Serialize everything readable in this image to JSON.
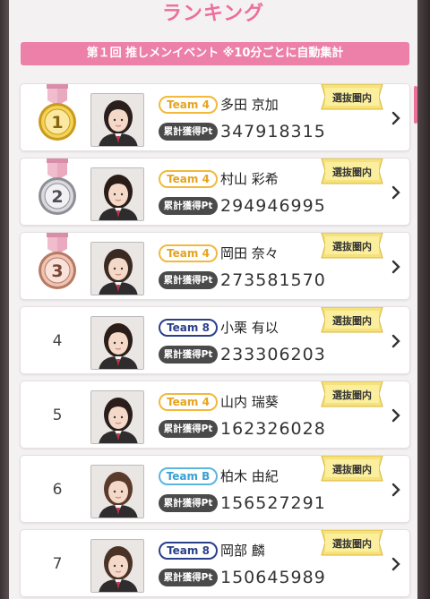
{
  "title": "ランキング",
  "banner": "第１回 推しメンイベント ※10分ごとに自動集計",
  "pt_label": "累計獲得Pt",
  "selected_label": "選抜圏内",
  "colors": {
    "accent_pink": "#ec6f9c",
    "banner_pink": "#ec80a8",
    "team4": "#f2b93b",
    "team8": "#2a3f8a",
    "teamB": "#5ab6e0",
    "gold": "#f4d35a",
    "silver": "#cfcfd4",
    "bronze": "#e8b9a8"
  },
  "rankings": [
    {
      "rank": "1",
      "medal": "gold-medal-icon",
      "team": "Team 4",
      "team_key": "team4",
      "name": "多田 京加",
      "points": "347918315",
      "selected": true
    },
    {
      "rank": "2",
      "medal": "silver-medal-icon",
      "team": "Team 4",
      "team_key": "team4",
      "name": "村山 彩希",
      "points": "294946995",
      "selected": true
    },
    {
      "rank": "3",
      "medal": "bronze-medal-icon",
      "team": "Team 4",
      "team_key": "team4",
      "name": "岡田 奈々",
      "points": "273581570",
      "selected": true
    },
    {
      "rank": "4",
      "medal": "",
      "team": "Team 8",
      "team_key": "team8",
      "name": "小栗 有以",
      "points": "233306203",
      "selected": true
    },
    {
      "rank": "5",
      "medal": "",
      "team": "Team 4",
      "team_key": "team4",
      "name": "山内 瑞葵",
      "points": "162326028",
      "selected": true
    },
    {
      "rank": "6",
      "medal": "",
      "team": "Team B",
      "team_key": "teamB",
      "name": "柏木 由紀",
      "points": "156527291",
      "selected": true
    },
    {
      "rank": "7",
      "medal": "",
      "team": "Team 8",
      "team_key": "team8",
      "name": "岡部 麟",
      "points": "150645989",
      "selected": true
    }
  ]
}
